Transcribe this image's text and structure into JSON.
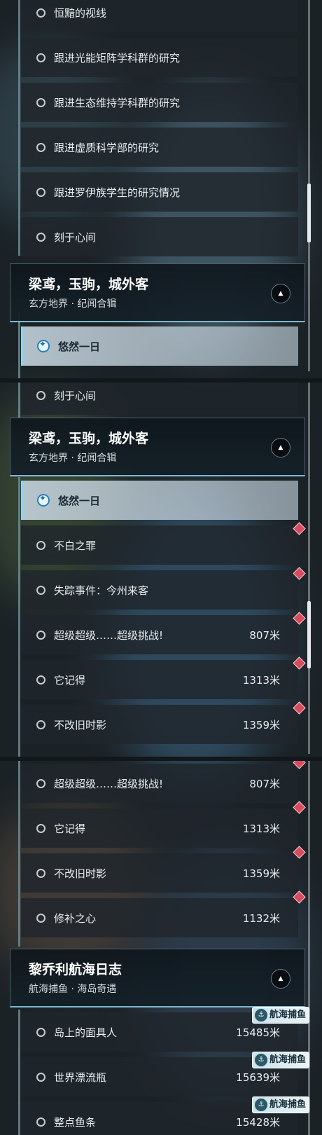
{
  "colors": {
    "accent": "#8fd3f0",
    "gem": "#d94b5e",
    "rail": "#6f8f9a"
  },
  "icons": {
    "radio": "radio-circle-icon",
    "target": "target-icon",
    "gem": "red-diamond-icon",
    "collapse": "caret-up-icon",
    "tag": "fishing-icon"
  },
  "panel1": {
    "items": [
      {
        "label": "恒黯的视线"
      },
      {
        "label": "跟进光能矩阵学科群的研究"
      },
      {
        "label": "跟进生态维持学科群的研究"
      },
      {
        "label": "跟进虚质科学部的研究"
      },
      {
        "label": "跟进罗伊族学生的研究情况"
      },
      {
        "label": "刻于心间"
      }
    ],
    "header": {
      "title": "梁鸢，玉驹，城外客",
      "subtitle": "玄方地界 · 纪闻合辑"
    },
    "selected": {
      "label": "悠然一日"
    }
  },
  "panel2": {
    "top_item": {
      "label": "刻于心间"
    },
    "header": {
      "title": "梁鸢，玉驹，城外客",
      "subtitle": "玄方地界 · 纪闻合辑"
    },
    "selected": {
      "label": "悠然一日"
    },
    "items": [
      {
        "label": "不白之罪",
        "dist": ""
      },
      {
        "label": "失踪事件：今州来客",
        "dist": ""
      },
      {
        "label": "超级超级……超级挑战!",
        "dist": "807米"
      },
      {
        "label": "它记得",
        "dist": "1313米"
      },
      {
        "label": "不改旧时影",
        "dist": "1359米"
      }
    ]
  },
  "panel3": {
    "items": [
      {
        "label": "超级超级……超级挑战!",
        "dist": "807米"
      },
      {
        "label": "它记得",
        "dist": "1313米"
      },
      {
        "label": "不改旧时影",
        "dist": "1359米"
      },
      {
        "label": "修补之心",
        "dist": "1132米"
      }
    ],
    "header": {
      "title": "黎乔利航海日志",
      "subtitle": "航海捕鱼 · 海岛奇遇"
    },
    "fish_items": [
      {
        "label": "岛上的面具人",
        "dist": "15485米",
        "tag": "航海捕鱼"
      },
      {
        "label": "世界漂流瓶",
        "dist": "15639米",
        "tag": "航海捕鱼"
      },
      {
        "label": "整点鱼条",
        "dist": "15428米",
        "tag": "航海捕鱼"
      }
    ]
  }
}
